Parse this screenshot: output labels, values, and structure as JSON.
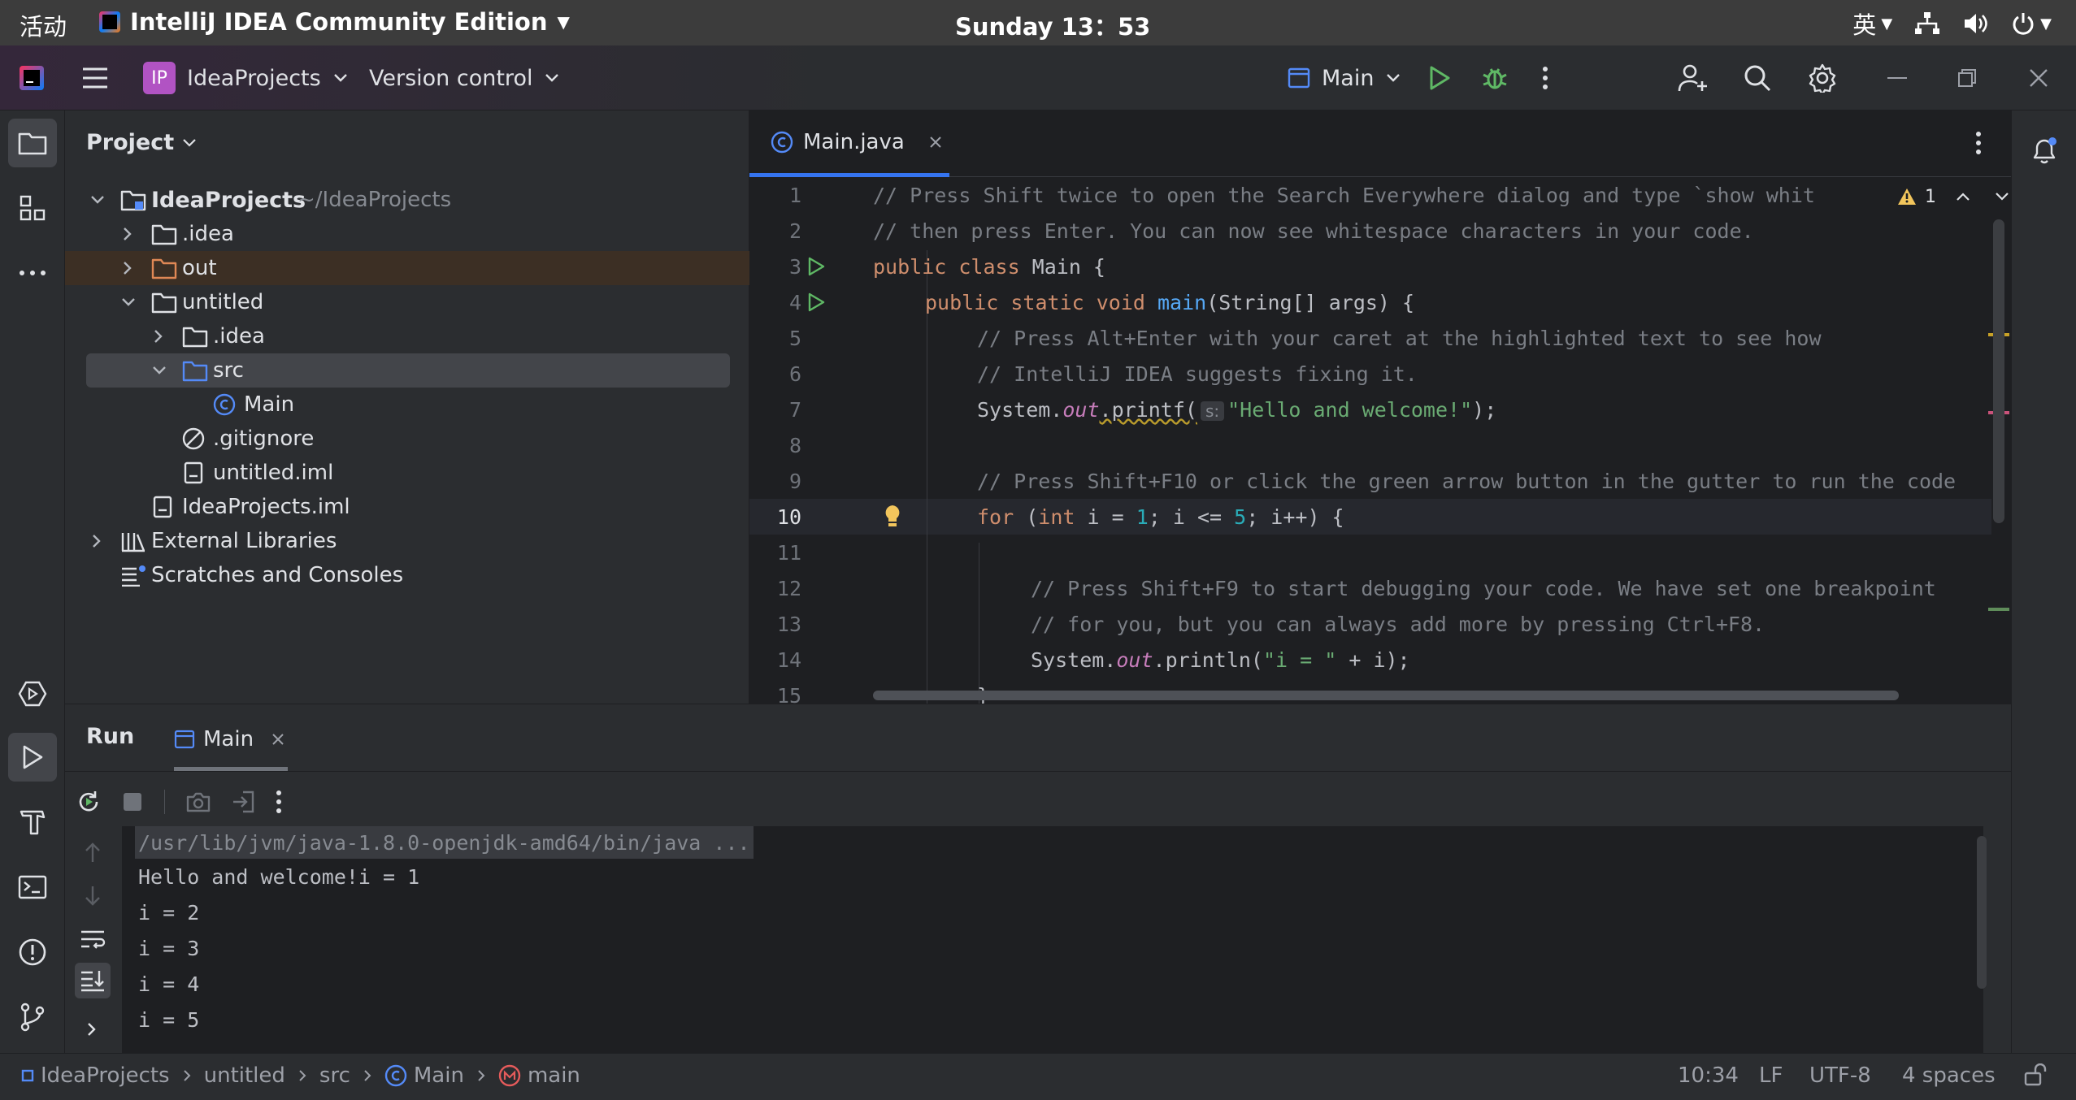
{
  "system_bar": {
    "activities": "活动",
    "app_name": "IntelliJ IDEA Community Edition",
    "clock": "Sunday 13：53",
    "input_method": "英"
  },
  "header": {
    "project_badge": "IP",
    "project_name": "IdeaProjects",
    "vcs_label": "Version control",
    "run_config": "Main"
  },
  "project_panel": {
    "title": "Project",
    "root_name": "IdeaProjects",
    "root_path": "~/IdeaProjects",
    "items": [
      {
        "label": ".idea"
      },
      {
        "label": "out"
      },
      {
        "label": "untitled"
      },
      {
        "label": ".idea"
      },
      {
        "label": "src"
      },
      {
        "label": "Main"
      },
      {
        "label": ".gitignore"
      },
      {
        "label": "untitled.iml"
      },
      {
        "label": "IdeaProjects.iml"
      },
      {
        "label": "External Libraries"
      },
      {
        "label": "Scratches and Consoles"
      }
    ]
  },
  "editor": {
    "tab_label": "Main.java",
    "warning_count": "1",
    "hint_label": "s:",
    "line_numbers": [
      "1",
      "2",
      "3",
      "4",
      "5",
      "6",
      "7",
      "8",
      "9",
      "10",
      "11",
      "12",
      "13",
      "14",
      "15"
    ],
    "lines": {
      "l1": "// Press Shift twice to open the Search Everywhere dialog and type `show white",
      "l2": "// then press Enter. You can now see whitespace characters in your code.",
      "l3_kw": "public class ",
      "l3_rest": "Main {",
      "l4_kw": "public static void ",
      "l4_fn": "main",
      "l4_rest": "(String[] args) {",
      "l5": "// Press Alt+Enter with your caret at the highlighted text to see how",
      "l6": "// IntelliJ IDEA suggests fixing it.",
      "l7_a": "System.",
      "l7_out": "out",
      "l7_b": ".printf(",
      "l7_str": "\"Hello and welcome!\"",
      "l7_c": ");",
      "l9": "// Press Shift+F10 or click the green arrow button in the gutter to run the code",
      "l10_for": "for ",
      "l10_a": "(",
      "l10_int": "int ",
      "l10_b": "i = ",
      "l10_n1": "1",
      "l10_c": "; i <= ",
      "l10_n5": "5",
      "l10_d": "; i++) {",
      "l12": "// Press Shift+F9 to start debugging your code. We have set one breakpoint",
      "l13": "// for you, but you can always add more by pressing Ctrl+F8.",
      "l14_a": "System.",
      "l14_out": "out",
      "l14_b": ".println(",
      "l14_str": "\"i = \"",
      "l14_c": " + i);",
      "l15": "}"
    }
  },
  "run_panel": {
    "title": "Run",
    "tab_label": "Main",
    "console_lines": [
      "/usr/lib/jvm/java-1.8.0-openjdk-amd64/bin/java ...",
      "Hello and welcome!i = 1",
      "i = 2",
      "i = 3",
      "i = 4",
      "i = 5"
    ]
  },
  "status_bar": {
    "breadcrumbs": [
      "IdeaProjects",
      "untitled",
      "src",
      "Main",
      "main"
    ],
    "position": "10:34",
    "line_separator": "LF",
    "encoding": "UTF-8",
    "indent": "4 spaces"
  },
  "colors": {
    "accent": "#3574f0",
    "run_green": "#5fb865",
    "folder_orange": "#e08855"
  }
}
